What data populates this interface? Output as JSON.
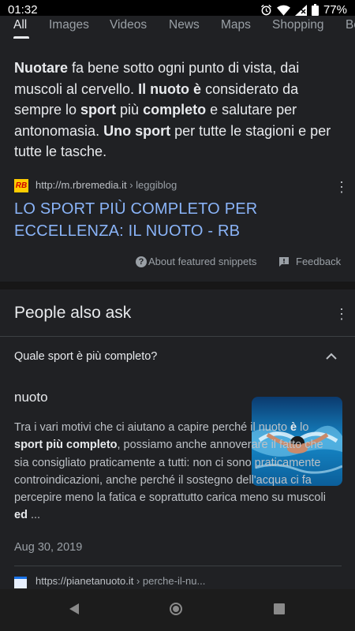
{
  "status_bar": {
    "time": "01:32",
    "battery": "77%"
  },
  "tabs": [
    "All",
    "Images",
    "Videos",
    "News",
    "Maps",
    "Shopping",
    "Bo"
  ],
  "featured_snippet": {
    "parts": [
      {
        "t": "Nuotare",
        "b": true
      },
      {
        "t": " fa bene sotto ogni punto di vista, dai muscoli al cervello. ",
        "b": false
      },
      {
        "t": "Il nuoto è",
        "b": true
      },
      {
        "t": " considerato da sempre lo ",
        "b": false
      },
      {
        "t": "sport",
        "b": true
      },
      {
        "t": " più ",
        "b": false
      },
      {
        "t": "completo",
        "b": true
      },
      {
        "t": " e salutare per antonomasia. ",
        "b": false
      },
      {
        "t": "Uno sport",
        "b": true
      },
      {
        "t": " per tutte le stagioni e per tutte le tasche.",
        "b": false
      }
    ],
    "favicon_text": "RB",
    "source_url": "http://m.rbremedia.it",
    "source_path": " › leggiblog",
    "title": "LO SPORT PIÙ COMPLETO PER ECCELLENZA: IL NUOTO - RB",
    "about_label": "About featured snippets",
    "feedback_label": "Feedback"
  },
  "people_also_ask": {
    "heading": "People also ask",
    "question": "Quale sport è più completo?",
    "answer_heading": "nuoto",
    "answer_parts": [
      {
        "t": "Tra i vari motivi che ci aiutano a capire perché il nuoto ",
        "b": false
      },
      {
        "t": "è",
        "b": true
      },
      {
        "t": " lo ",
        "b": false
      },
      {
        "t": "sport più completo",
        "b": true
      },
      {
        "t": ", possiamo anche annoverare il fatto che sia consigliato praticamente a tutti: non ci sono praticamente controindicazioni, anche perché il sostegno dell'acqua ci fa percepire meno la fatica e soprattutto carica meno su muscoli ",
        "b": false
      },
      {
        "t": "ed",
        "b": true
      },
      {
        "t": " ...",
        "b": false
      }
    ],
    "date": "Aug 30, 2019",
    "source_url": "https://pianetanuoto.it",
    "source_path": " › perche-il-nu..."
  }
}
